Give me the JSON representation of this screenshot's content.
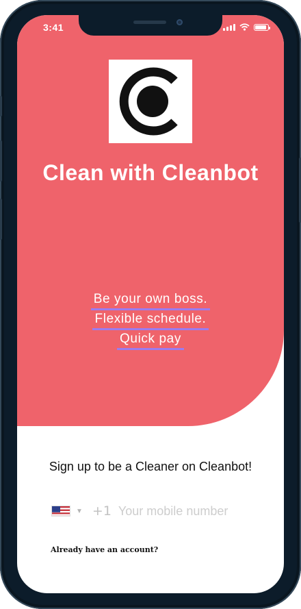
{
  "status_bar": {
    "time": "3:41",
    "battery_level": 0.9
  },
  "hero": {
    "background_color": "#ef636b",
    "logo_icon": "cleanbot-c-logo",
    "title": "Clean with Cleanbot",
    "taglines": [
      "Be your own boss.",
      "Flexible schedule.",
      "Quick pay"
    ],
    "tagline_underline_color": "#9a7cf0"
  },
  "signup": {
    "heading": "Sign up to be a Cleaner on Cleanbot!",
    "country_flag_icon": "us-flag-icon",
    "country_code": "+1",
    "mobile_placeholder": "Your mobile number",
    "mobile_value": ""
  },
  "login": {
    "link_text": "Already have an account?"
  }
}
